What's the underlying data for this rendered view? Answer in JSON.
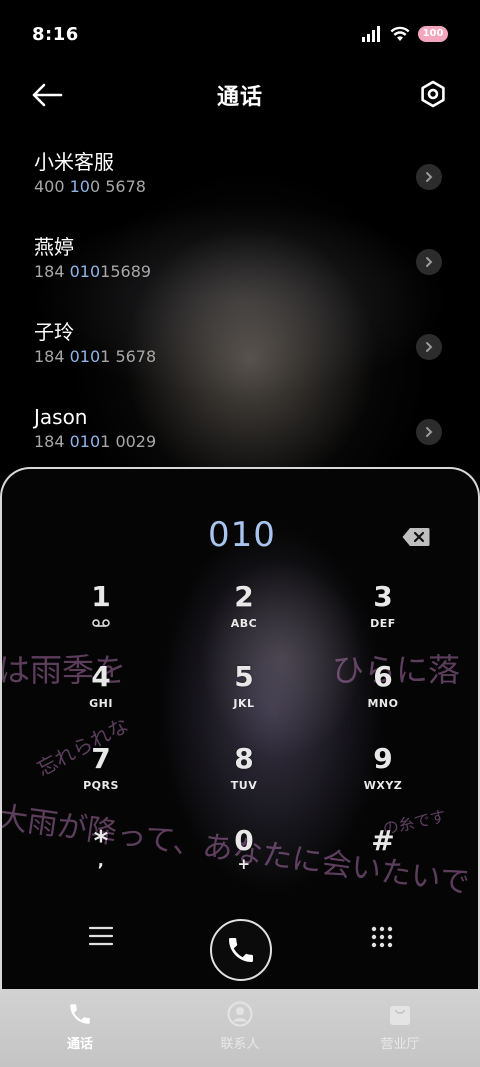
{
  "status_bar": {
    "time": "8:16",
    "battery": "100",
    "icons": [
      "signal-icon",
      "wifi-icon",
      "battery-icon"
    ]
  },
  "header": {
    "title": "通话",
    "back_icon": "back-arrow-icon",
    "settings_icon": "settings-hexagon-icon"
  },
  "contacts": [
    {
      "name": "小米客服",
      "number_pre": "400 ",
      "number_hl": "10",
      "number_mid": "0 ",
      "number_hl2": "",
      "number_post": "5678"
    },
    {
      "name": "燕婷",
      "number_pre": "184 ",
      "number_hl": "010",
      "number_mid": "",
      "number_hl2": "",
      "number_post": "15689"
    },
    {
      "name": "子玲",
      "number_pre": "184 ",
      "number_hl": "010",
      "number_mid": "1 ",
      "number_hl2": "",
      "number_post": "5678"
    },
    {
      "name": "Jason",
      "number_pre": "184 ",
      "number_hl": "010",
      "number_mid": "1 ",
      "number_hl2": "",
      "number_post": "0029"
    }
  ],
  "dialer": {
    "entered_number": "010",
    "keys": [
      {
        "digit": "1",
        "letters": ""
      },
      {
        "digit": "2",
        "letters": "ABC"
      },
      {
        "digit": "3",
        "letters": "DEF"
      },
      {
        "digit": "4",
        "letters": "GHI"
      },
      {
        "digit": "5",
        "letters": "JKL"
      },
      {
        "digit": "6",
        "letters": "MNO"
      },
      {
        "digit": "7",
        "letters": "PQRS"
      },
      {
        "digit": "8",
        "letters": "TUV"
      },
      {
        "digit": "9",
        "letters": "WXYZ"
      },
      {
        "digit": "*",
        "letters": ","
      },
      {
        "digit": "0",
        "letters": "+"
      },
      {
        "digit": "#",
        "letters": ""
      }
    ],
    "wallpaper_text": [
      "は雨季を",
      "ひらに落",
      "大雨が降って、あなたに会いたいで",
      "忘れられな",
      "の糸です"
    ]
  },
  "bottom_nav": [
    {
      "label": "通话",
      "icon": "phone-icon",
      "active": true
    },
    {
      "label": "联系人",
      "icon": "person-icon",
      "active": false
    },
    {
      "label": "营业厅",
      "icon": "shopping-bag-icon",
      "active": false
    }
  ],
  "colors": {
    "highlight": "#8fb4e8",
    "dial_number": "#a8c4ef",
    "nav_bg": "#c9c9c9",
    "battery": "#f3a6be"
  }
}
